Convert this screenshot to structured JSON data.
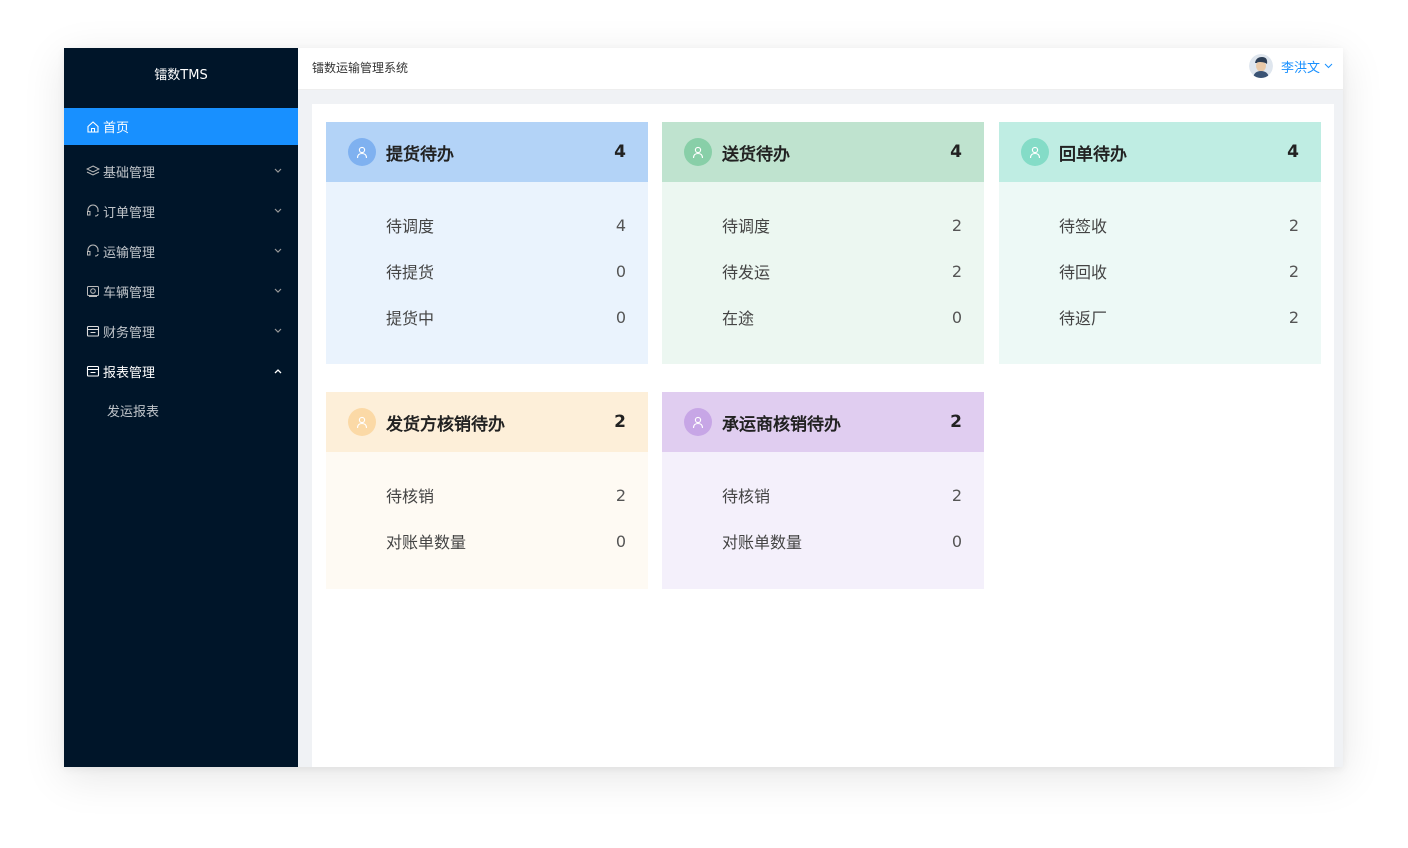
{
  "sidebar": {
    "logo": "镭数TMS",
    "items": [
      {
        "label": "首页"
      },
      {
        "label": "基础管理"
      },
      {
        "label": "订单管理"
      },
      {
        "label": "运输管理"
      },
      {
        "label": "车辆管理"
      },
      {
        "label": "财务管理"
      },
      {
        "label": "报表管理"
      }
    ],
    "submenu": [
      {
        "label": "发运报表"
      }
    ]
  },
  "header": {
    "title": "镭数运输管理系统",
    "user_name": "李洪文"
  },
  "cards": [
    {
      "title": "提货待办",
      "count": "4",
      "head_color": "#b3d3f7",
      "body_color": "#eaf3fd",
      "icon_color": "#7fb1f0",
      "rows": [
        {
          "label": "待调度",
          "value": "4"
        },
        {
          "label": "待提货",
          "value": "0"
        },
        {
          "label": "提货中",
          "value": "0"
        }
      ]
    },
    {
      "title": "送货待办",
      "count": "4",
      "head_color": "#bfe3cf",
      "body_color": "#ecf7f1",
      "icon_color": "#88cfa8",
      "rows": [
        {
          "label": "待调度",
          "value": "2"
        },
        {
          "label": "待发运",
          "value": "2"
        },
        {
          "label": "在途",
          "value": "0"
        }
      ]
    },
    {
      "title": "回单待办",
      "count": "4",
      "head_color": "#bfede3",
      "body_color": "#edf9f6",
      "icon_color": "#84dcc7",
      "rows": [
        {
          "label": "待签收",
          "value": "2"
        },
        {
          "label": "待回收",
          "value": "2"
        },
        {
          "label": "待返厂",
          "value": "2"
        }
      ]
    },
    {
      "title": "发货方核销待办",
      "count": "2",
      "head_color": "#fdefd9",
      "body_color": "#fefaf3",
      "icon_color": "#fbd9a6",
      "rows": [
        {
          "label": "待核销",
          "value": "2"
        },
        {
          "label": "对账单数量",
          "value": "0"
        }
      ]
    },
    {
      "title": "承运商核销待办",
      "count": "2",
      "head_color": "#e0cdf0",
      "body_color": "#f4f0fb",
      "icon_color": "#c7a6e6",
      "rows": [
        {
          "label": "待核销",
          "value": "2"
        },
        {
          "label": "对账单数量",
          "value": "0"
        }
      ]
    }
  ]
}
